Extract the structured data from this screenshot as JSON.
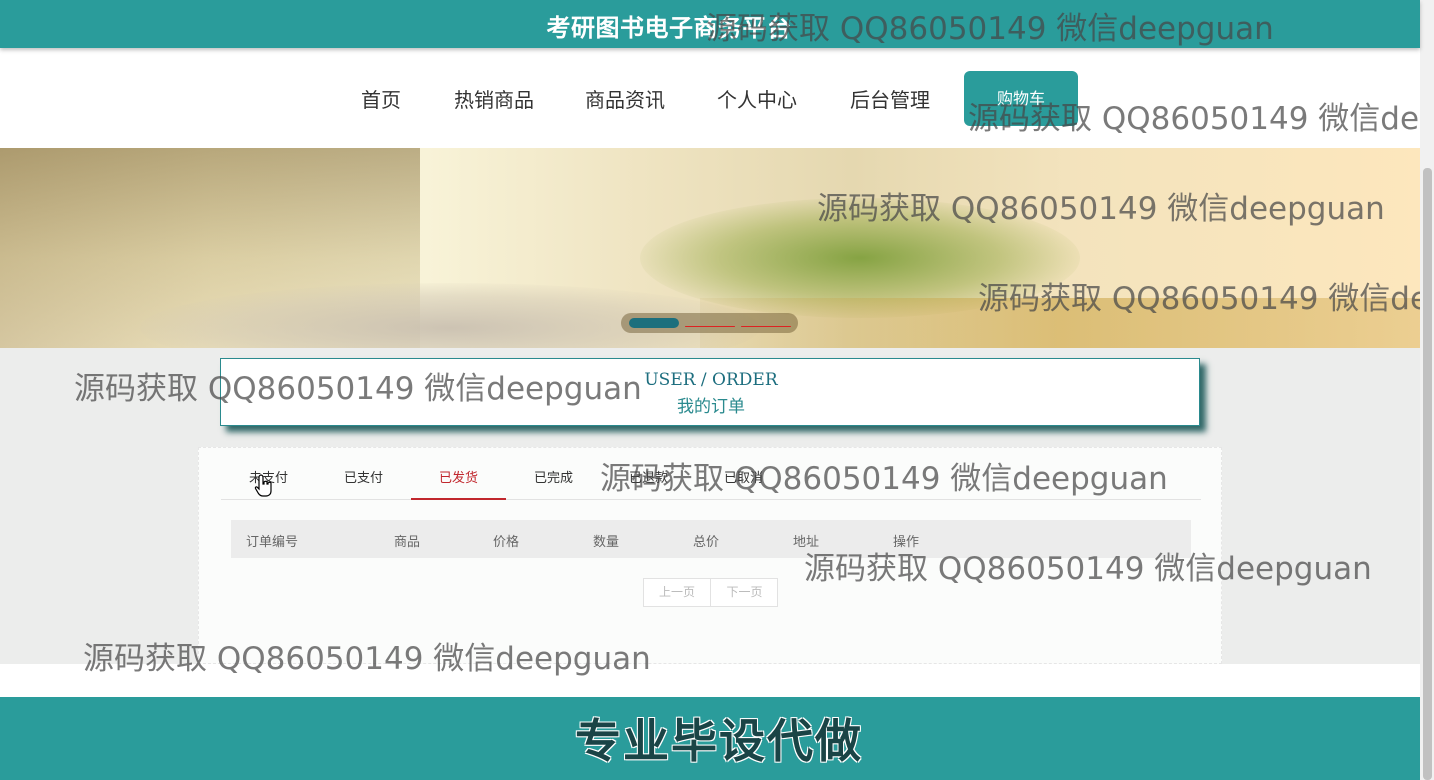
{
  "header": {
    "site_title": "考研图书电子商务平台"
  },
  "nav": {
    "items": [
      "首页",
      "热销商品",
      "商品资讯",
      "个人中心",
      "后台管理"
    ],
    "cart_label": "购物车"
  },
  "banner": {
    "slides": 3,
    "active_slide": 1
  },
  "section": {
    "title_en": "USER / ORDER",
    "title_cn": "我的订单"
  },
  "tabs": {
    "items": [
      "未支付",
      "已支付",
      "已发货",
      "已完成",
      "已退款",
      "已取消"
    ],
    "active": "已发货"
  },
  "table": {
    "headers": [
      "订单编号",
      "商品",
      "价格",
      "数量",
      "总价",
      "地址",
      "操作"
    ]
  },
  "pager": {
    "prev": "上一页",
    "next": "下一页"
  },
  "footer": {
    "text": "专业毕设代做"
  },
  "watermark": {
    "text": "源码获取 QQ86050149 微信deepguan"
  },
  "colors": {
    "primary": "#2a9c9b",
    "active_tab": "#c1272d",
    "heading": "#1d6e7f"
  }
}
